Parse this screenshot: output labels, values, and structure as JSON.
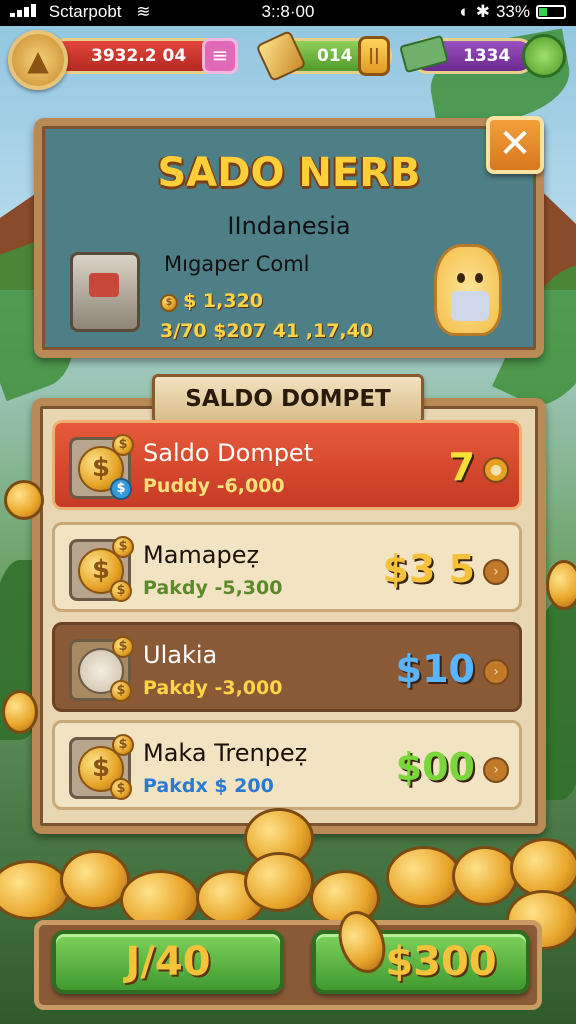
{
  "status_bar": {
    "carrier": "Sctarpobt",
    "time": "3::8·00",
    "battery": "33%"
  },
  "hud": {
    "balance": "3932.2 04",
    "coins_counter": "014",
    "cash_counter": "1334"
  },
  "promo_panel": {
    "title": "SADO NERB",
    "subtitle": "IIndanesia",
    "promo_name": "Mıgaper Coml",
    "line1": "$ 1,320",
    "line2": "3/70 $207 41 ,17,40"
  },
  "wallet": {
    "banner": "SALDO DOMPET",
    "rows": [
      {
        "title": "Saldo Dompet",
        "sub": "Puddy -6,000",
        "value": "7",
        "value_color": "#f5e03a"
      },
      {
        "title": "Mamapeẓ",
        "sub": "Pakdy -5,300",
        "value": "$3 5",
        "value_color": "#f5c23a"
      },
      {
        "title": "Ulakia",
        "sub": "Pakdy -3,000",
        "value": "$10",
        "value_color": "#5ab4ff"
      },
      {
        "title": "Maka Trenpeẓ",
        "sub": "Pakdx $ 200",
        "value": "$00",
        "value_color": "#7ad63a"
      }
    ]
  },
  "bottom": {
    "left_button": "J/40",
    "right_button": "$300"
  },
  "colors": {
    "gold": "#ffcf3a",
    "wood": "#b98a55",
    "green_button": "#3f9a2e"
  }
}
